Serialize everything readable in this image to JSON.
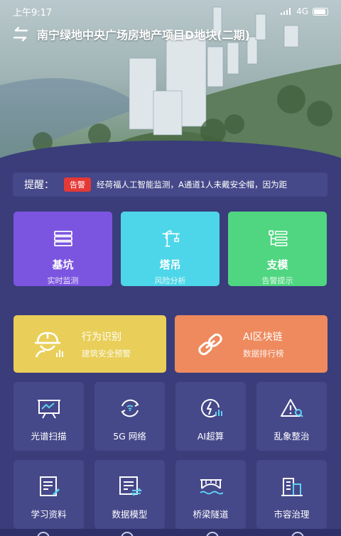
{
  "status_bar": {
    "time": "上午9:17",
    "network": "4G"
  },
  "header": {
    "project_title": "南宁绿地中央广场房地产项目D地块(二期)"
  },
  "reminder": {
    "label": "提醒：",
    "badge": "告警",
    "message": "经荷福人工智能监测，A通道1人未戴安全帽，因为距"
  },
  "cards_top": [
    {
      "title": "基坑",
      "subtitle": "实时监测",
      "icon": "list-icon",
      "color": "#7b55e0"
    },
    {
      "title": "塔吊",
      "subtitle": "风险分析",
      "icon": "tower-crane-icon",
      "color": "#4dd6e9"
    },
    {
      "title": "支模",
      "subtitle": "告警提示",
      "icon": "tree-structure-icon",
      "color": "#50d681"
    }
  ],
  "cards_mid": [
    {
      "title": "行为识别",
      "subtitle": "建筑安全预警",
      "icon": "worker-helmet-icon",
      "color": "#e9cf59"
    },
    {
      "title": "AI区块链",
      "subtitle": "数据排行榜",
      "icon": "chain-link-icon",
      "color": "#ee8a5e"
    }
  ],
  "tiles_row1": [
    {
      "label": "光谱扫描",
      "icon": "spectrum-scan-icon"
    },
    {
      "label": "5G 网络",
      "icon": "5g-network-icon"
    },
    {
      "label": "AI超算",
      "icon": "ai-compute-icon"
    },
    {
      "label": "乱象整治",
      "icon": "warning-search-icon"
    }
  ],
  "tiles_row2": [
    {
      "label": "学习资料",
      "icon": "study-document-icon"
    },
    {
      "label": "数据模型",
      "icon": "data-model-icon"
    },
    {
      "label": "桥梁隧道",
      "icon": "bridge-tunnel-icon"
    },
    {
      "label": "市容治理",
      "icon": "city-building-icon"
    }
  ],
  "colors": {
    "background": "#3a3d7a",
    "tile": "#454889",
    "alert": "#e53935"
  }
}
